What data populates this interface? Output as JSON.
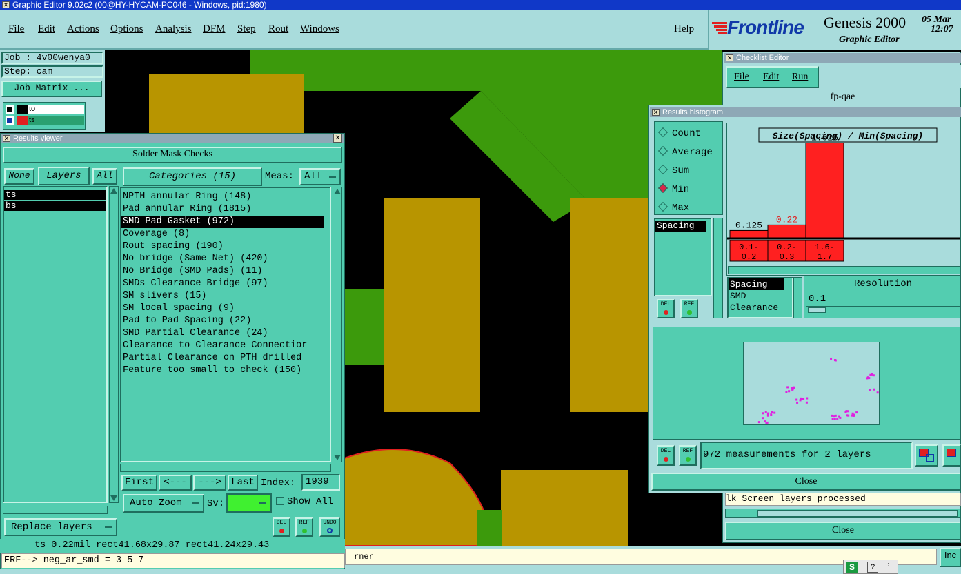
{
  "window_title": "Graphic Editor 9.02c2 (00@HY-HYCAM-PC046 - Windows, pid:1980)",
  "menu": [
    "File",
    "Edit",
    "Actions",
    "Options",
    "Analysis",
    "DFM",
    "Step",
    "Rout",
    "Windows"
  ],
  "help": "Help",
  "brand": {
    "logo": "Frontline",
    "product": "Genesis 2000",
    "date": "05 Mar",
    "time": "12:07",
    "subtitle": "Graphic Editor"
  },
  "job": {
    "job_label": "Job : 4v00wenya0",
    "step_label": "Step: cam",
    "matrix_button": "Job Matrix ..."
  },
  "layers_mini": [
    {
      "name": "to"
    },
    {
      "name": "ts"
    }
  ],
  "results_viewer": {
    "title": "Results viewer",
    "header": "Solder Mask Checks",
    "none_btn": "None",
    "layers_btn": "Layers",
    "all_btn": "All",
    "layers": [
      "ts",
      "bs"
    ],
    "categories_btn": "Categories (15)",
    "meas_label": "Meas:",
    "meas_value": "All",
    "categories": [
      "NPTH annular Ring (148)",
      "Pad annular Ring (1815)",
      "SMD Pad Gasket (972)",
      "Coverage (8)",
      "Rout spacing (190)",
      "No bridge (Same Net) (420)",
      "No Bridge (SMD Pads) (11)",
      "SMDs Clearance Bridge (97)",
      "SM slivers (15)",
      "SM local spacing (9)",
      "Pad to Pad Spacing (22)",
      "SMD Partial Clearance (24)",
      "Clearance to Clearance Connectior",
      "Partial Clearance on PTH drilled",
      "Feature too small to check (150)"
    ],
    "selected_index": 2,
    "first": "First",
    "prev": "<---",
    "next": "--->",
    "last": "Last",
    "index_label": "Index:",
    "index_value": "1939",
    "auto_zoom": "Auto Zoom",
    "sv_label": "Sv:",
    "show_all": "Show All",
    "replace_layers": "Replace layers",
    "del": "DEL",
    "ref": "REF",
    "undo": "UNDO"
  },
  "status_line": "ts 0.22mil  rect41.68x29.87  rect41.24x29.43",
  "erf_line": "ERF--> neg_ar_smd = 3 5 7",
  "bottom_text": "rner",
  "checklist": {
    "title": "Checklist Editor",
    "menu": [
      "File",
      "Edit",
      "Run"
    ],
    "name": "fp-qae",
    "status": "lk Screen layers processed",
    "close": "Close"
  },
  "histogram": {
    "title": "Results histogram",
    "modes": [
      "Count",
      "Average",
      "Sum",
      "Min",
      "Max"
    ],
    "selected_mode": "Min",
    "attribute": "Spacing",
    "metrics": [
      "Spacing",
      "SMD",
      "Clearance"
    ],
    "resolution_label": "Resolution",
    "resolution_value": "0.1",
    "measurements": "972 measurements for 2 layers",
    "close": "Close",
    "del": "DEL",
    "ref": "REF",
    "colors": {
      "bar": "#ff2020",
      "bg": "#a9dcdc",
      "points": "#e020e0"
    }
  },
  "chart_data": {
    "type": "bar",
    "title": "Size(Spacing) / Min(Spacing)",
    "categories": [
      "0.1-\n0.2",
      "0.2-\n0.3",
      "1.6-\n1.7"
    ],
    "values": [
      0.125,
      0.22,
      1.625
    ],
    "value_labels": [
      "0.125",
      "0.22",
      "1.625"
    ],
    "ylim": [
      0,
      1.8
    ]
  }
}
